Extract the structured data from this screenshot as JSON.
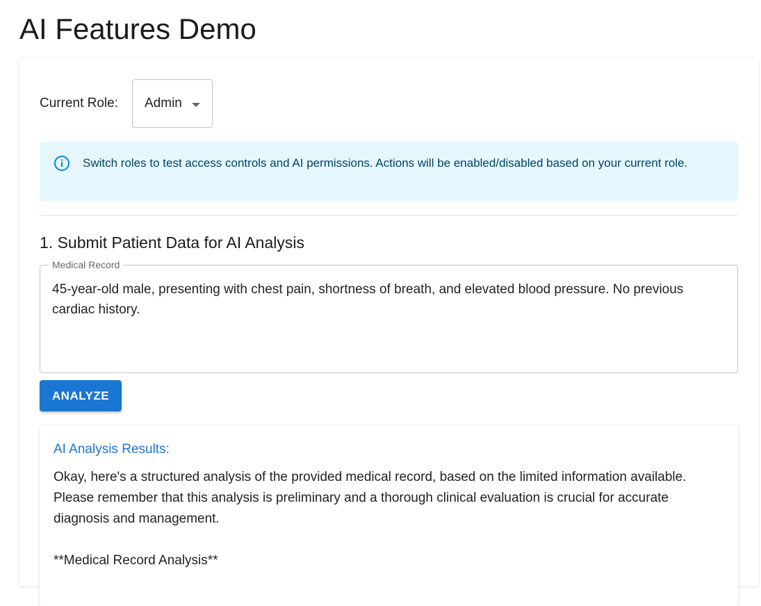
{
  "page": {
    "title": "AI Features Demo"
  },
  "role": {
    "label": "Current Role:",
    "selected": "Admin"
  },
  "alert": {
    "icon": "info-circle-icon",
    "text": "Switch roles to test access controls and AI permissions. Actions will be enabled/disabled based on your current role."
  },
  "section1": {
    "title": "1. Submit Patient Data for AI Analysis",
    "field_label": "Medical Record",
    "field_value": "45-year-old male, presenting with chest pain, shortness of breath, and elevated blood pressure. No previous cardiac history.",
    "button_label": "ANALYZE"
  },
  "results": {
    "title": "AI Analysis Results:",
    "body": "Okay, here's a structured analysis of the provided medical record, based on the limited information available. Please remember that this analysis is preliminary and a thorough clinical evaluation is crucial for accurate diagnosis and management.\n\n**Medical Record Analysis**"
  },
  "colors": {
    "primary": "#1976d2",
    "info_bg": "#e5f6fd",
    "info_text": "#014361"
  }
}
